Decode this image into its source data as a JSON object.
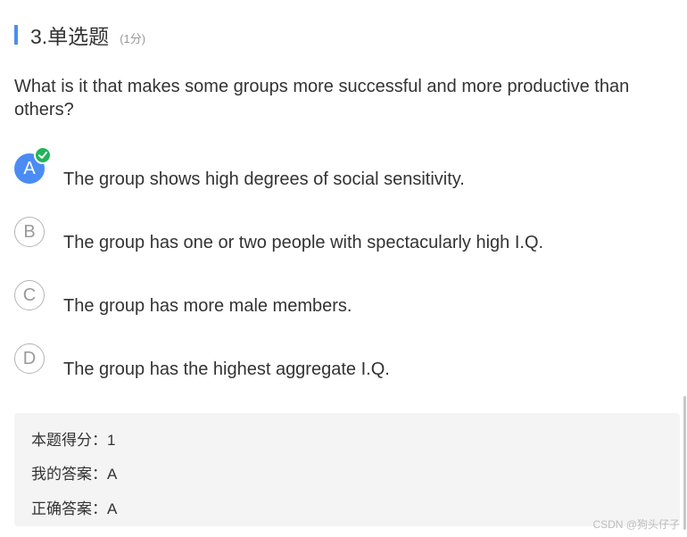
{
  "question_header": {
    "title": "3.单选题",
    "score": "(1分)"
  },
  "question": {
    "text": "What is it that makes some groups more successful and more productive than others?"
  },
  "options": [
    {
      "letter": "A",
      "text": "The group shows high degrees of social sensitivity.",
      "selected": true,
      "correct": true
    },
    {
      "letter": "B",
      "text": "The group has one or two people with spectacularly high I.Q."
    },
    {
      "letter": "C",
      "text": "The group has more male members."
    },
    {
      "letter": "D",
      "text": "The group has the highest aggregate I.Q."
    }
  ],
  "result": {
    "score_line": "本题得分：1",
    "my_answer_line": "我的答案：A",
    "correct_answer_line": "正确答案：A"
  },
  "watermark": "CSDN @狗头仔子",
  "colors": {
    "accent": "#4a8ff0",
    "selected": "#4b8cf4",
    "check": "#22b35b",
    "result_bg": "#f4f4f4"
  },
  "icons": {
    "check": "check-circle-icon"
  }
}
